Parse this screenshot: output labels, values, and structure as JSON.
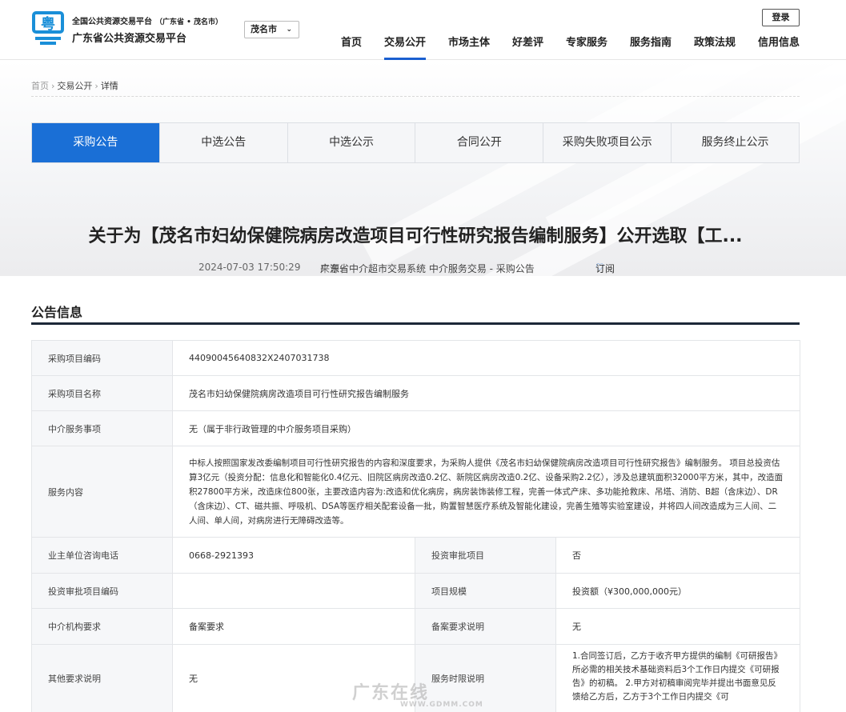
{
  "header": {
    "logo_char": "粤",
    "site_name_line1": "全国公共资源交易平台",
    "site_region": "（广东省 • 茂名市）",
    "site_name_line2": "广东省公共资源交易平台",
    "city_select": "茂名市",
    "login_label": "登录",
    "nav": [
      "首页",
      "交易公开",
      "市场主体",
      "好差评",
      "专家服务",
      "服务指南",
      "政策法规",
      "信用信息"
    ],
    "nav_active": "交易公开"
  },
  "breadcrumb": [
    "首页",
    "交易公开",
    "详情"
  ],
  "tabs": [
    "采购公告",
    "中选公告",
    "中选公示",
    "合同公开",
    "采购失败项目公示",
    "服务终止公示"
  ],
  "tab_active": "采购公告",
  "notice": {
    "title": "关于为【茂名市妇幼保健院病房改造项目可行性研究报告编制服务】公开选取【工...",
    "datetime": "2024-07-03 17:50:29",
    "source_label": "来源:",
    "source_value": "广东省中介超市交易系统 中介服务交易 - 采购公告",
    "subscribe_label": "订阅"
  },
  "section_title": "公告信息",
  "info": {
    "row1": {
      "label": "采购项目编码",
      "value": "44090045640832X2407031738"
    },
    "row2": {
      "label": "采购项目名称",
      "value": "茂名市妇幼保健院病房改造项目可行性研究报告编制服务"
    },
    "row3": {
      "label": "中介服务事项",
      "value": "无（属于非行政管理的中介服务项目采购）"
    },
    "row4": {
      "label": "服务内容",
      "value": "中标人按照国家发改委编制项目可行性研究报告的内容和深度要求，为采购人提供《茂名市妇幼保健院病房改造项目可行性研究报告》编制服务。 项目总投资估算3亿元（投资分配：信息化和智能化0.4亿元、旧院区病房改造0.2亿、新院区病房改造0.2亿、设备采购2.2亿），涉及总建筑面积32000平方米，其中，改造面积27800平方米，改造床位800张，主要改造内容为:改造和优化病房，病房装饰装修工程，完善一体式产床、多功能抢救床、吊塔、消防、B超（含床边）、DR（含床边）、CT、磁共振、呼吸机、DSA等医疗相关配套设备一批，购置智慧医疗系统及智能化建设，完善生殖等实验室建设，并将四人间改造成为三人间、二人间、单人间，对病房进行无障碍改造等。"
    },
    "row5": {
      "label_a": "业主单位咨询电话",
      "value_a": "0668-2921393",
      "label_b": "投资审批项目",
      "value_b": "否"
    },
    "row6": {
      "label_a": "投资审批项目编码",
      "value_a": "",
      "label_b": "项目规模",
      "value_b": "投资额（¥300,000,000元）"
    },
    "row7": {
      "label_a": "中介机构要求",
      "value_a": "备案要求",
      "label_b": "备案要求说明",
      "value_b": "无"
    },
    "row8": {
      "label_a": "其他要求说明",
      "value_a": "无",
      "label_b": "服务时限说明",
      "value_b": "1.合同签订后，乙方于收齐甲方提供的编制《可研报告》所必需的相关技术基础资料后3个工作日内提交《可研报告》的初稿。 2.甲方对初稿审阅完毕并提出书面意见反馈给乙方后，乙方于3个工作日内提交《可"
    }
  },
  "watermark": {
    "text": "广东在线",
    "sub": "WWW.GDMM.COM"
  },
  "colors": {
    "accent": "#1a6fd6",
    "section_rule": "#1c2838",
    "label_bg": "#f6f7f9"
  }
}
